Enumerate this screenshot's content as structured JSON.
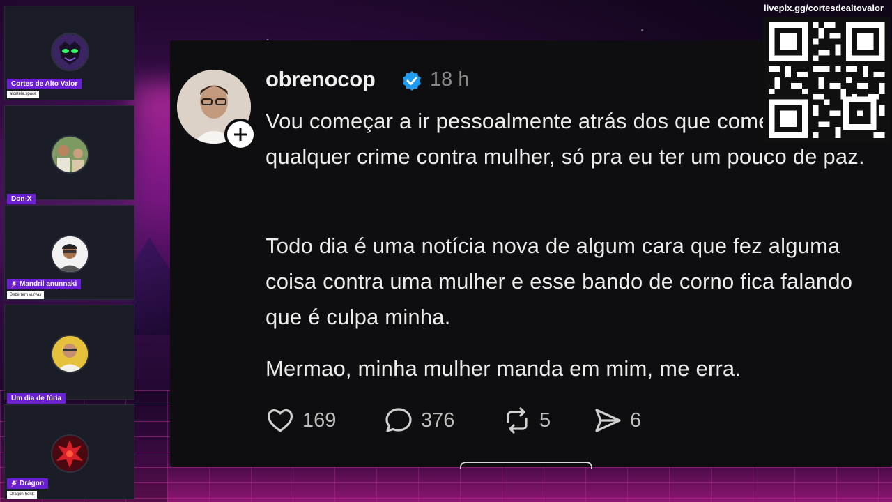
{
  "sidebar": {
    "participants": [
      {
        "name": "Cortes de Alto Valor",
        "subtitle": "alcateia.space",
        "muted": false
      },
      {
        "name": "Don-X",
        "subtitle": "",
        "muted": false
      },
      {
        "name": "Mandril anunnaki",
        "subtitle": "Bezerrem vurvas",
        "muted": true
      },
      {
        "name": "Um dia de fúria",
        "subtitle": "",
        "muted": false
      },
      {
        "name": "Drágon",
        "subtitle": "Dragon-honk",
        "muted": true
      }
    ]
  },
  "post": {
    "username": "obrenocop",
    "verified": true,
    "time": "18 h",
    "paragraphs": [
      "Vou começar a ir pessoalmente atrás dos que cometem qualquer crime contra mulher, só pra eu ter um pouco de paz.",
      "Todo dia é uma notícia nova de algum cara que fez alguma coisa contra uma mulher e esse bando de corno fica falando que é culpa minha.",
      "Mermao, minha mulher manda em mim, me erra."
    ],
    "likes": "169",
    "comments": "376",
    "reposts": "5",
    "shares": "6"
  },
  "qr": {
    "url": "livepix.gg/cortesdealtovalor"
  },
  "colors": {
    "name_tag": "#6a1fd0",
    "card_bg": "#0e0e10",
    "verified": "#1d9bf0"
  }
}
